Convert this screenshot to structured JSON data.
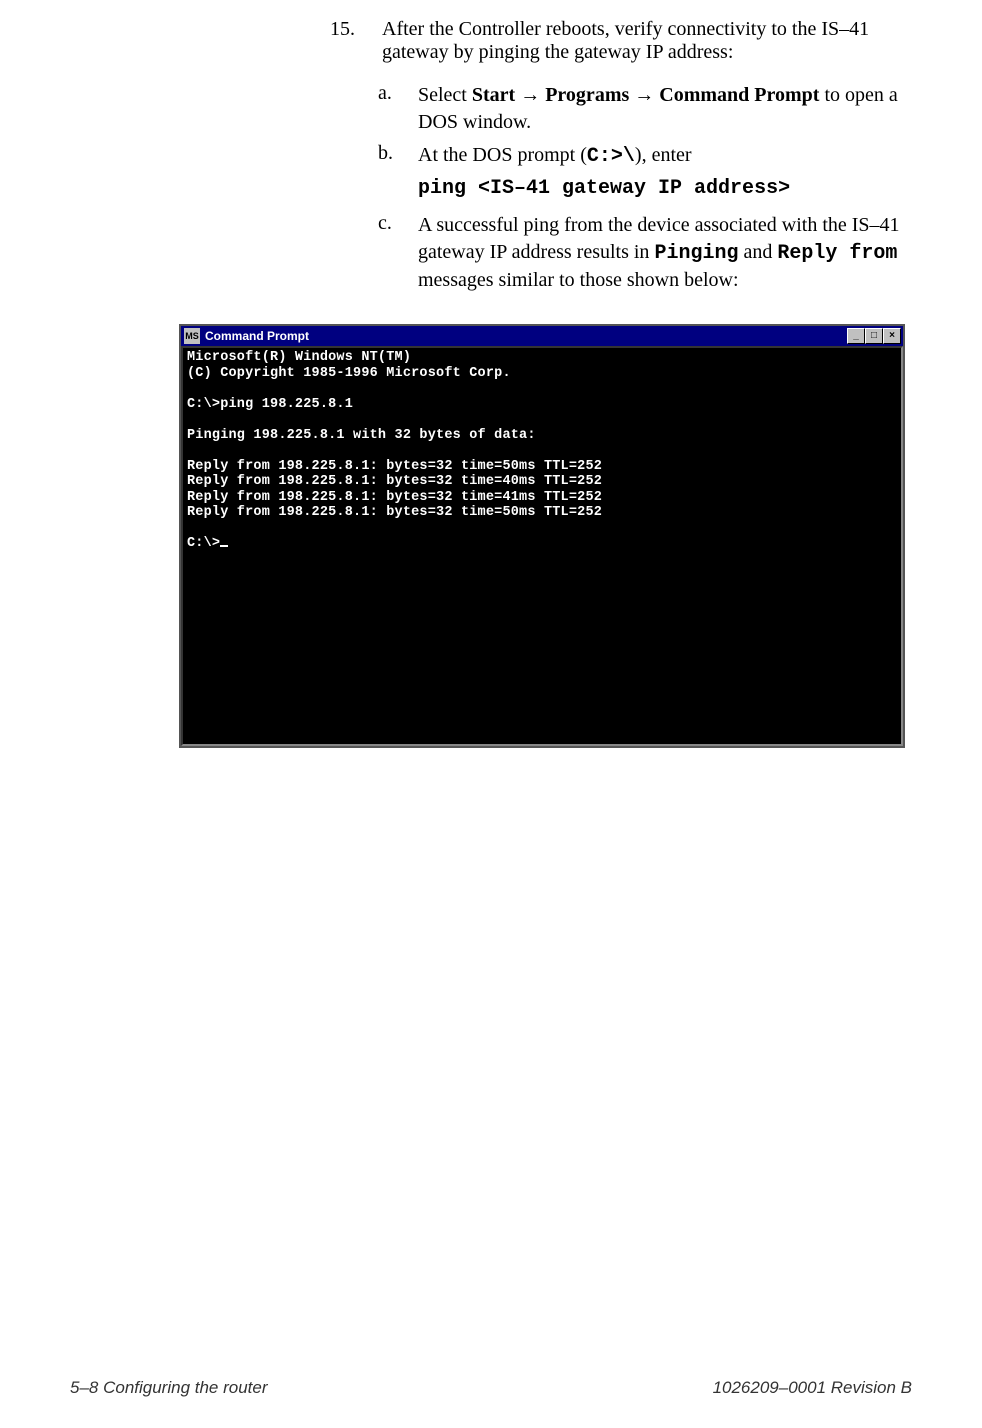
{
  "step": {
    "number": "15.",
    "text_before": "After the Controller reboots, verify connectivity to the IS–41 gateway by pinging the gateway IP address:"
  },
  "sub_a": {
    "label": "a.",
    "pre": "Select ",
    "m1": "Start",
    "arr1": " → ",
    "m2": "Programs",
    "arr2": " → ",
    "m3": "Command Prompt",
    "post": " to open a DOS window."
  },
  "sub_b": {
    "label": "b.",
    "pre": "At the DOS prompt (",
    "prompt": "C:>\\",
    "post": "), enter",
    "cmd_pre": "ping",
    "cmd_arg": " <IS–41 gateway IP address>"
  },
  "sub_c": {
    "label": "c.",
    "t1": "A successful ping from the device associated with the IS–41 gateway IP address results in ",
    "m1": "Pinging",
    "t2": " and ",
    "m2": "Reply from",
    "t3": " messages similar to those shown below:"
  },
  "terminal": {
    "icon_text": "MS",
    "title": "Command Prompt",
    "btn_min": "_",
    "btn_max": "□",
    "btn_close": "×",
    "lines": [
      "Microsoft(R) Windows NT(TM)",
      "(C) Copyright 1985-1996 Microsoft Corp.",
      "",
      "C:\\>ping 198.225.8.1",
      "",
      "Pinging 198.225.8.1 with 32 bytes of data:",
      "",
      "Reply from 198.225.8.1: bytes=32 time=50ms TTL=252",
      "Reply from 198.225.8.1: bytes=32 time=40ms TTL=252",
      "Reply from 198.225.8.1: bytes=32 time=41ms TTL=252",
      "Reply from 198.225.8.1: bytes=32 time=50ms TTL=252",
      "",
      "C:\\>"
    ]
  },
  "footer": {
    "left": "5–8  Configuring the router",
    "right": "1026209–0001  Revision B"
  }
}
